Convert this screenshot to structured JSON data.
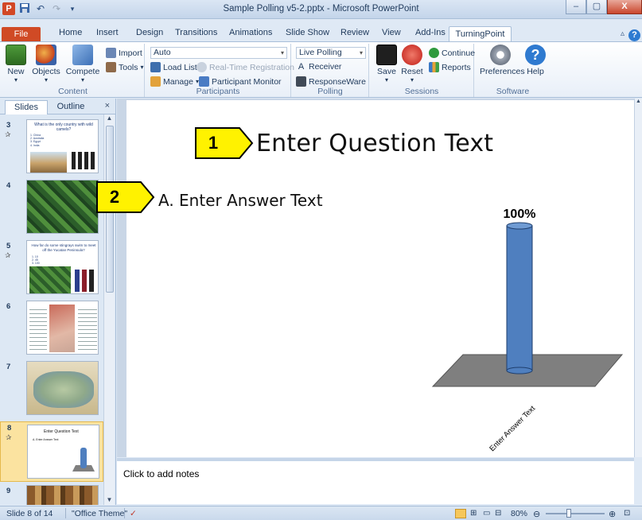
{
  "window": {
    "title": "Sample Polling v5-2.pptx - Microsoft PowerPoint",
    "controls": {
      "minimize": "–",
      "maximize": "▢",
      "close": "X"
    }
  },
  "ribbon_tabs": [
    "File",
    "Home",
    "Insert",
    "Design",
    "Transitions",
    "Animations",
    "Slide Show",
    "Review",
    "View",
    "Add-Ins",
    "TurningPoint"
  ],
  "active_tab": "TurningPoint",
  "ribbon": {
    "content": {
      "label": "Content",
      "new": "New",
      "objects": "Objects",
      "compete": "Compete",
      "import": "Import",
      "tools": "Tools"
    },
    "participants": {
      "label": "Participants",
      "mode_value": "Auto",
      "load_list": "Load List",
      "realtime": "Real-Time Registration",
      "manage": "Manage",
      "monitor": "Participant Monitor"
    },
    "polling": {
      "label": "Polling",
      "mode_value": "Live Polling",
      "receiver": "Receiver",
      "responseware": "ResponseWare"
    },
    "sessions": {
      "label": "Sessions",
      "save": "Save",
      "reset": "Reset",
      "continue": "Continue",
      "reports": "Reports"
    },
    "software": {
      "label": "Software",
      "preferences": "Preferences",
      "help": "Help"
    }
  },
  "pane": {
    "tabs": [
      "Slides",
      "Outline"
    ],
    "active": "Slides",
    "close": "×",
    "thumbnails": [
      {
        "num": "3",
        "star": "✰",
        "title": "What is the only country with wild camels?",
        "items": [
          "1. China",
          "2. Australia",
          "3. Egypt",
          "4. India"
        ]
      },
      {
        "num": "4",
        "star": "",
        "title": "",
        "items": []
      },
      {
        "num": "5",
        "star": "✰",
        "title": "How far do some stingrays swim to meet off the Yucatan Peninsula?",
        "items": [
          "1. 10",
          "2. 45",
          "3. 100"
        ]
      },
      {
        "num": "6",
        "star": "",
        "title": "",
        "items": []
      },
      {
        "num": "7",
        "star": "",
        "title": "",
        "items": []
      },
      {
        "num": "8",
        "star": "✰",
        "title": "Enter Question Text",
        "items": [
          "A. Enter Answer Text"
        ]
      },
      {
        "num": "9",
        "star": "",
        "title": "",
        "items": []
      }
    ],
    "selected": "8"
  },
  "slide": {
    "callout1": "1",
    "callout2": "2",
    "question": "Enter Question Text",
    "answer": "A.  Enter Answer Text"
  },
  "chart_data": {
    "type": "bar",
    "categories": [
      "Enter Answer Text"
    ],
    "values": [
      100
    ],
    "data_labels": [
      "100%"
    ],
    "ylim": [
      0,
      100
    ],
    "colors": {
      "bar": "#4f7fbf",
      "floor": "#7f7f7f"
    }
  },
  "notes": {
    "placeholder": "Click to add notes"
  },
  "status": {
    "slide": "Slide 8 of 14",
    "theme": "\"Office Theme\"",
    "zoom": "80%"
  }
}
